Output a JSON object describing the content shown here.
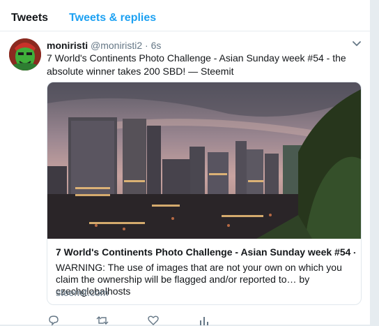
{
  "tabs": {
    "tweets": "Tweets",
    "replies": "Tweets & replies"
  },
  "tweet": {
    "name": "moniristi",
    "handle": "@moniristi2",
    "dot": "·",
    "time": "6s",
    "text": "7 World's Continents Photo Challenge - Asian Sunday week #54 - the absolute winner takes 200 SBD! — Steemit",
    "card": {
      "title": "7 World's Continents Photo Challenge - Asian Sunday week #54 -...",
      "description": "WARNING: The use of images that are not your own on which you claim the ownership will be flagged and/or reported to… by czechglobalhosts",
      "domain": "steemit.com"
    }
  },
  "colors": {
    "accent": "#1da1f2",
    "muted": "#657786",
    "text": "#14171a"
  },
  "icons": [
    "chevron-down-icon",
    "reply-icon",
    "retweet-icon",
    "like-icon",
    "analytics-icon"
  ]
}
